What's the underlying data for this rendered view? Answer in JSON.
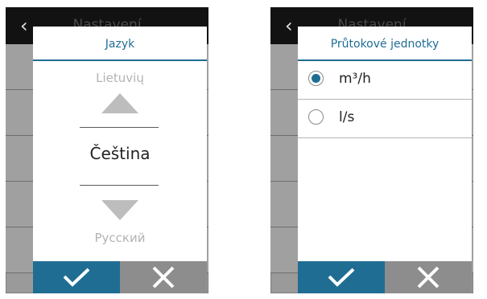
{
  "left_screen": {
    "header_title": "Nastavení",
    "dialog": {
      "title": "Jazyk",
      "prev_language": "Lietuvių",
      "current_language": "Čeština",
      "next_language": "Русский"
    },
    "buttons": {
      "confirm": "check-icon",
      "cancel": "close-icon"
    }
  },
  "right_screen": {
    "header_title": "Nastavení",
    "dialog": {
      "title": "Průtokové jednotky",
      "options": [
        {
          "label": "m³/h",
          "selected": true
        },
        {
          "label": "l/s",
          "selected": false
        }
      ]
    },
    "buttons": {
      "confirm": "check-icon",
      "cancel": "close-icon"
    }
  },
  "colors": {
    "accent": "#1f6d93",
    "cancel_button": "#8d8d8d",
    "background_overlay": "#9a9a9a"
  }
}
